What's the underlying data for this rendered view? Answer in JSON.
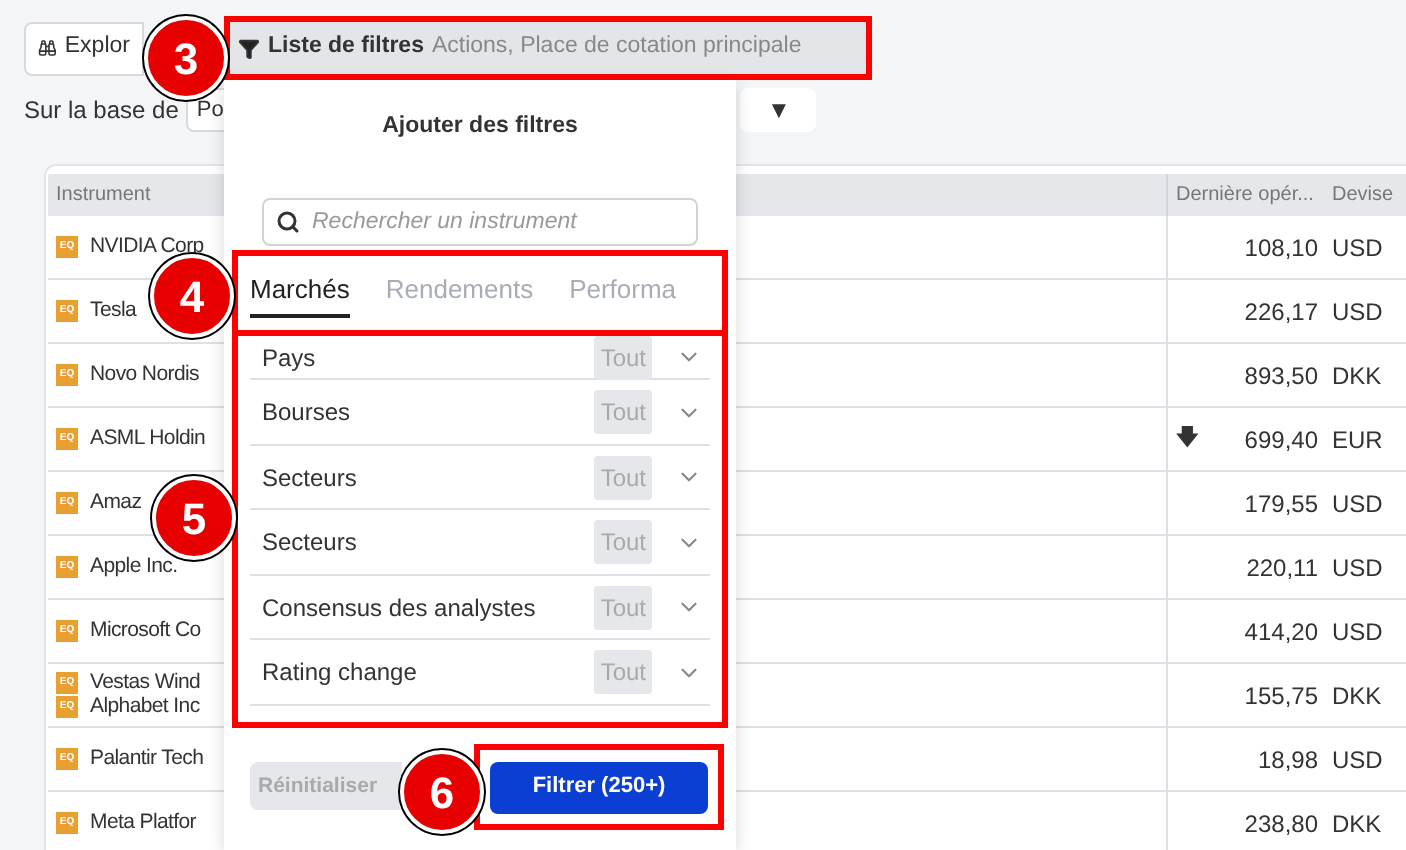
{
  "toolbar": {
    "explorer_button": "Explor",
    "filter_list": {
      "label": "Liste de filtres",
      "summary": "Actions, Place de cotation principale"
    }
  },
  "basis": {
    "label": "Sur la base de",
    "value": "Po",
    "dropdown": "▼"
  },
  "table": {
    "columns": [
      "Instrument",
      "Dernière opér...",
      "Devise"
    ],
    "rows": [
      {
        "badge": "EQ",
        "names": [
          "NVIDIA Corp"
        ],
        "price": "108,10",
        "currency": "USD"
      },
      {
        "badge": "EQ",
        "names": [
          "Tesla"
        ],
        "price": "226,17",
        "currency": "USD"
      },
      {
        "badge": "EQ",
        "names": [
          "Novo Nordis"
        ],
        "price": "893,50",
        "currency": "DKK"
      },
      {
        "badge": "EQ",
        "names": [
          "ASML Holdin"
        ],
        "price": "699,40",
        "currency": "EUR",
        "arrow": "🡇"
      },
      {
        "badge": "EQ",
        "names": [
          "Amaz"
        ],
        "price": "179,55",
        "currency": "USD"
      },
      {
        "badge": "EQ",
        "names": [
          "Apple Inc."
        ],
        "price": "220,11",
        "currency": "USD"
      },
      {
        "badge": "EQ",
        "names": [
          "Microsoft Co"
        ],
        "price": "414,20",
        "currency": "USD"
      },
      {
        "badge": "EQ",
        "names": [
          "Vestas Wind"
        ],
        "extra": [
          {
            "badge": "EQ",
            "name": "Alphabet Inc"
          }
        ],
        "price": "155,75",
        "currency": "DKK"
      },
      {
        "badge": "EQ",
        "names": [
          "Palantir Tech"
        ],
        "price": "18,98",
        "currency": "USD"
      },
      {
        "badge": "EQ",
        "names": [
          "Meta Platfor"
        ],
        "price": "238,80",
        "currency": "DKK"
      }
    ]
  },
  "filter_popup": {
    "title": "Ajouter des filtres",
    "search": {
      "placeholder": "Rechercher un instrument"
    },
    "tabs": [
      {
        "label": "Marchés",
        "selected": true
      },
      {
        "label": "Rendements",
        "selected": false
      },
      {
        "label": "Performa",
        "selected": false
      }
    ],
    "filters": [
      {
        "label": "Pays",
        "value": "Tout"
      },
      {
        "label": "Bourses",
        "value": "Tout"
      },
      {
        "label": "Secteurs",
        "value": "Tout"
      },
      {
        "label": "Secteurs",
        "value": "Tout"
      },
      {
        "label": "Consensus des analystes",
        "value": "Tout"
      },
      {
        "label": "Rating change",
        "value": "Tout"
      }
    ],
    "reset_button": "Réinitialiser",
    "filter_button": "Filtrer (250+)"
  },
  "annotations": [
    "3",
    "4",
    "5",
    "6"
  ]
}
